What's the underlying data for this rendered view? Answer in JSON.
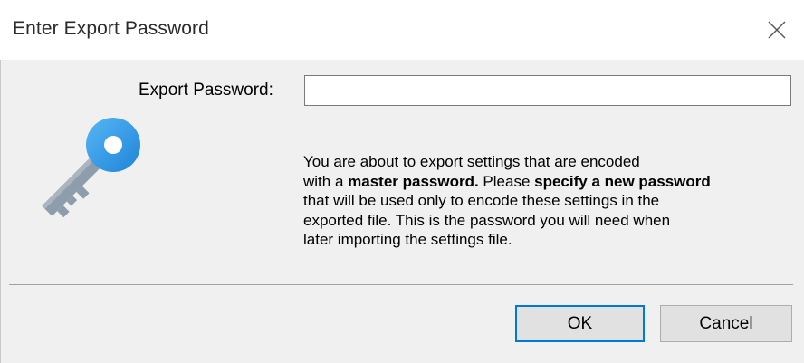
{
  "dialog": {
    "title": "Enter Export Password",
    "close_icon": "close-icon",
    "icon": "key-icon"
  },
  "form": {
    "password_label": "Export Password:",
    "password_value": ""
  },
  "message": {
    "line1": "You are about to export settings that are encoded",
    "line2_prefix": "with a ",
    "line2_bold1": "master password.",
    "line2_mid": " Please ",
    "line2_bold2": "specify a new password",
    "line3": "that will be used only to encode these settings in the",
    "line4": "exported file. This is the password you will need when",
    "line5": "later importing the settings file."
  },
  "buttons": {
    "ok_label": "OK",
    "cancel_label": "Cancel"
  },
  "colors": {
    "accent": "#0078d7",
    "key_blue": "#3aa0e8",
    "key_gray": "#8e9dab"
  }
}
